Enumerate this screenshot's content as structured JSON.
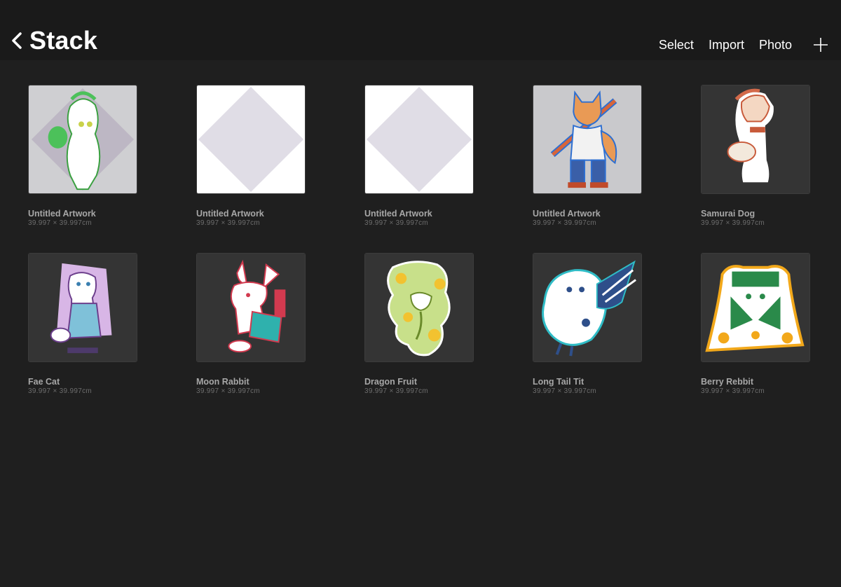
{
  "header": {
    "title": "Stack",
    "actions": {
      "select": "Select",
      "import": "Import",
      "photo": "Photo"
    }
  },
  "artworks": [
    {
      "name": "Untitled Artwork",
      "dims": "39.997 × 39.997cm"
    },
    {
      "name": "Untitled Artwork",
      "dims": "39.997 × 39.997cm"
    },
    {
      "name": "Untitled Artwork",
      "dims": "39.997 × 39.997cm"
    },
    {
      "name": "Untitled Artwork",
      "dims": "39.997 × 39.997cm"
    },
    {
      "name": "Samurai Dog",
      "dims": "39.997 × 39.997cm"
    },
    {
      "name": "Fae Cat",
      "dims": "39.997 × 39.997cm"
    },
    {
      "name": "Moon Rabbit",
      "dims": "39.997 × 39.997cm"
    },
    {
      "name": "Dragon Fruit",
      "dims": "39.997 × 39.997cm"
    },
    {
      "name": "Long Tail Tit",
      "dims": "39.997 × 39.997cm"
    },
    {
      "name": "Berry Rebbit",
      "dims": "39.997 × 39.997cm"
    }
  ]
}
